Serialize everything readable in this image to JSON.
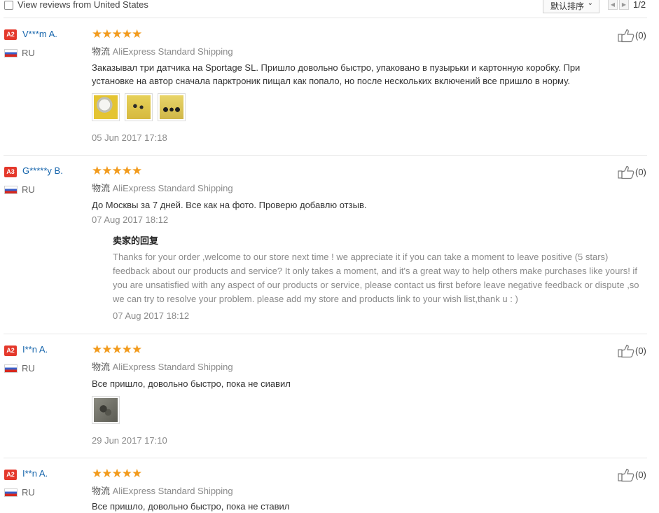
{
  "filter": {
    "label": "View reviews from United States",
    "checked": false
  },
  "sort": {
    "selected": "默认排序"
  },
  "pagination": {
    "text": "1/2"
  },
  "shipping_label": "物流",
  "reply_title": "卖家的回复",
  "colors": {
    "accent_star": "#f29b1d",
    "username": "#1665ac",
    "level_badge": "#e4382b"
  },
  "reviews": [
    {
      "level": "A2",
      "user": "V***m A.",
      "country": "RU",
      "stars": "★★★★★",
      "rating": 5,
      "shipping": "AliExpress Standard Shipping",
      "text": "Заказывал три датчика на Sportage SL. Пришло довольно быстро, упаковано в пузырьки и картонную коробку. При установке на автор сначала парктроник пищал как попало, но после нескольких включений все пришло в норму.",
      "date": "05 Jun 2017 17:18",
      "likes": "(0)"
    },
    {
      "level": "A3",
      "user": "G*****y B.",
      "country": "RU",
      "stars": "★★★★★",
      "rating": 5,
      "shipping": "AliExpress Standard Shipping",
      "text": "До Москвы за 7 дней. Все как на фото. Проверю добавлю отзыв.",
      "date": "07 Aug 2017 18:12",
      "likes": "(0)",
      "reply": {
        "text": "Thanks for your order ,welcome to our store next time ! we appreciate it if you can take a moment to leave positive (5 stars) feedback about our products and service? It only takes a moment, and it's a great way to help others make purchases like yours! if you are unsatisfied with any aspect of our products or service, please contact us first before leave negative feedback or dispute ,so we can try to resolve your problem. please add my store and products link to your wish list,thank u : )",
        "date": "07 Aug 2017 18:12"
      }
    },
    {
      "level": "A2",
      "user": "I**n A.",
      "country": "RU",
      "stars": "★★★★★",
      "rating": 5,
      "shipping": "AliExpress Standard Shipping",
      "text": "Все пришло, довольно быстро, пока не сиавил",
      "date": "29 Jun 2017 17:10",
      "likes": "(0)"
    },
    {
      "level": "A2",
      "user": "I**n A.",
      "country": "RU",
      "stars": "★★★★★",
      "rating": 5,
      "shipping": "AliExpress Standard Shipping",
      "text": "Все пришло, довольно быстро, пока не ставил",
      "likes": "(0)"
    }
  ]
}
